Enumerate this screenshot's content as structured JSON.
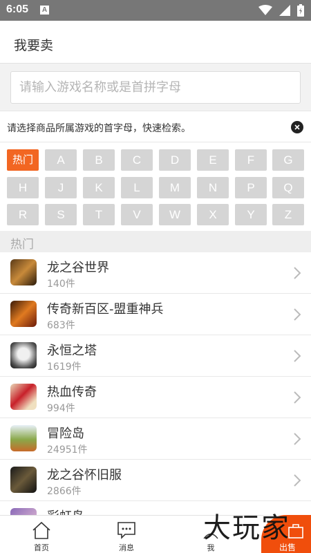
{
  "status_bar": {
    "time": "6:05",
    "notification_badge": "A",
    "icons": [
      "wifi-icon",
      "signal-icon",
      "battery-icon"
    ]
  },
  "header": {
    "title": "我要卖"
  },
  "search": {
    "placeholder": "请输入游戏名称或是首拼字母"
  },
  "tip": {
    "text": "请选择商品所属游戏的首字母，快速检索。"
  },
  "letters": [
    "热门",
    "A",
    "B",
    "C",
    "D",
    "E",
    "F",
    "G",
    "H",
    "J",
    "K",
    "L",
    "M",
    "N",
    "P",
    "Q",
    "R",
    "S",
    "T",
    "V",
    "W",
    "X",
    "Y",
    "Z"
  ],
  "section": {
    "label": "热门"
  },
  "games": [
    {
      "name": "龙之谷世界",
      "count": "140件"
    },
    {
      "name": "传奇新百区-盟重神兵",
      "count": "683件"
    },
    {
      "name": "永恒之塔",
      "count": "1619件"
    },
    {
      "name": "热血传奇",
      "count": "994件"
    },
    {
      "name": "冒险岛",
      "count": "24951件"
    },
    {
      "name": "龙之谷怀旧服",
      "count": "2866件"
    },
    {
      "name": "彩虹岛",
      "count": ""
    }
  ],
  "tabs": {
    "home": "首页",
    "messages": "消息",
    "me": "我",
    "sell": "出售"
  },
  "watermark": "大玩家",
  "colors": {
    "accent": "#f26622",
    "status_bar": "#777777",
    "letter_bg": "#d5d5d5"
  }
}
